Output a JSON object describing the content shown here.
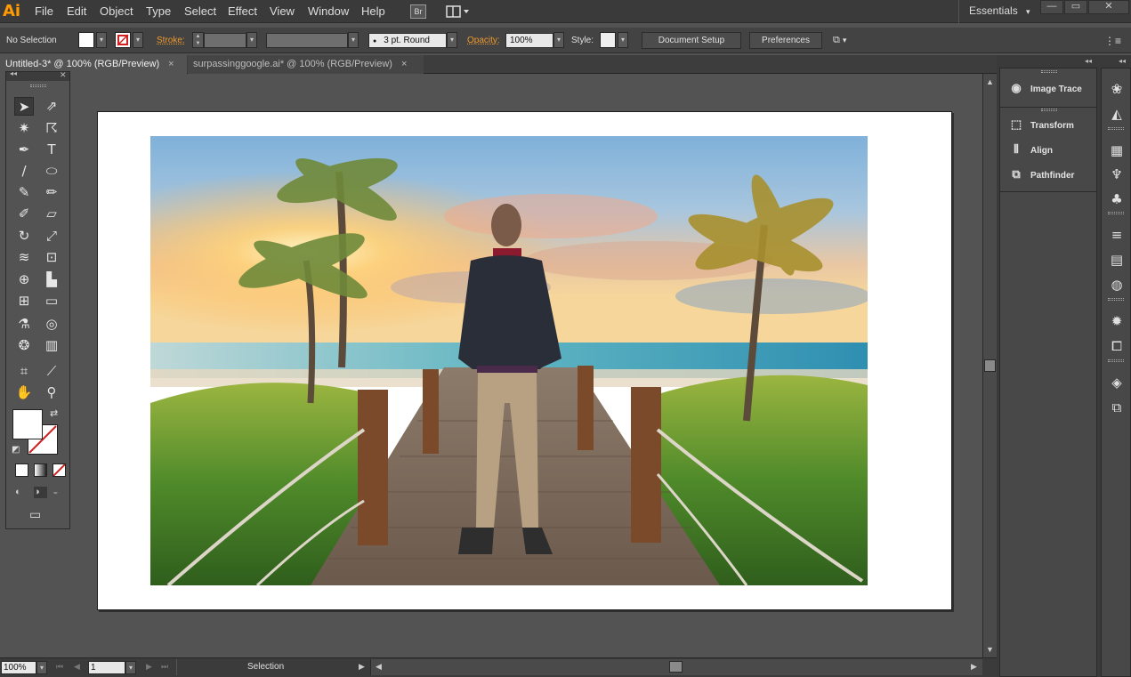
{
  "app": {
    "logo": "Ai"
  },
  "menu": [
    "File",
    "Edit",
    "Object",
    "Type",
    "Select",
    "Effect",
    "View",
    "Window",
    "Help"
  ],
  "bridge_label": "Br",
  "workspace": {
    "label": "Essentials",
    "caret": "▾"
  },
  "window_controls": {
    "minimize": "—",
    "restore": "▭",
    "close": "✕"
  },
  "control_bar": {
    "selection_status": "No Selection",
    "stroke_label": "Stroke:",
    "brush_value": "3 pt. Round",
    "opacity_label": "Opacity:",
    "opacity_value": "100%",
    "style_label": "Style:",
    "document_setup": "Document Setup",
    "preferences": "Preferences"
  },
  "tabs": [
    {
      "label": "Untitled-3* @ 100% (RGB/Preview)",
      "close": "×"
    },
    {
      "label": "surpassinggoogle.ai* @ 100% (RGB/Preview)",
      "close": "×"
    }
  ],
  "tools_panel": {
    "tools": [
      {
        "name": "selection-tool-icon",
        "glyph": "➤"
      },
      {
        "name": "direct-selection-tool-icon",
        "glyph": "⇗"
      },
      {
        "name": "magic-wand-tool-icon",
        "glyph": "✷"
      },
      {
        "name": "lasso-tool-icon",
        "glyph": "☈"
      },
      {
        "name": "pen-tool-icon",
        "glyph": "✒"
      },
      {
        "name": "type-tool-icon",
        "glyph": "T"
      },
      {
        "name": "line-tool-icon",
        "glyph": "∕"
      },
      {
        "name": "ellipse-tool-icon",
        "glyph": "⬭"
      },
      {
        "name": "paintbrush-tool-icon",
        "glyph": "✎"
      },
      {
        "name": "pencil-tool-icon",
        "glyph": "✏"
      },
      {
        "name": "blob-brush-tool-icon",
        "glyph": "✐"
      },
      {
        "name": "eraser-tool-icon",
        "glyph": "▱"
      },
      {
        "name": "rotate-tool-icon",
        "glyph": "↻"
      },
      {
        "name": "scale-tool-icon",
        "glyph": "⤢"
      },
      {
        "name": "width-tool-icon",
        "glyph": "≋"
      },
      {
        "name": "free-transform-tool-icon",
        "glyph": "⊡"
      },
      {
        "name": "shape-builder-tool-icon",
        "glyph": "⊕"
      },
      {
        "name": "graph-tool-icon",
        "glyph": "▙"
      },
      {
        "name": "mesh-tool-icon",
        "glyph": "⊞"
      },
      {
        "name": "gradient-tool-icon",
        "glyph": "▭"
      },
      {
        "name": "eyedropper-tool-icon",
        "glyph": "⚗"
      },
      {
        "name": "blend-tool-icon",
        "glyph": "◎"
      },
      {
        "name": "symbol-sprayer-tool-icon",
        "glyph": "❂"
      },
      {
        "name": "column-graph-tool-icon",
        "glyph": "▥"
      },
      {
        "name": "artboard-tool-icon",
        "glyph": "⌗"
      },
      {
        "name": "slice-tool-icon",
        "glyph": "⟋"
      },
      {
        "name": "hand-tool-icon",
        "glyph": "✋"
      },
      {
        "name": "zoom-tool-icon",
        "glyph": "⚲"
      }
    ],
    "color_modes": [
      "■",
      "◧",
      "⊘"
    ],
    "draw_modes": [
      "◐",
      "◑",
      "◒"
    ],
    "screen_mode": "▭"
  },
  "status_bar": {
    "zoom": "100%",
    "artboard_number": "1",
    "status_label": "Selection"
  },
  "right_panels": [
    {
      "name": "image-trace",
      "label": "Image Trace",
      "icon": "◉"
    },
    {
      "name": "transform",
      "label": "Transform",
      "icon": "⬚"
    },
    {
      "name": "align",
      "label": "Align",
      "icon": "⫴"
    },
    {
      "name": "pathfinder",
      "label": "Pathfinder",
      "icon": "⧉"
    }
  ],
  "dock_icons": [
    {
      "name": "color-guide-icon",
      "glyph": "❀"
    },
    {
      "name": "color-icon",
      "glyph": "◭"
    },
    {
      "name": "swatches-icon",
      "glyph": "▦"
    },
    {
      "name": "brushes-icon",
      "glyph": "♆"
    },
    {
      "name": "symbols-icon",
      "glyph": "♣"
    },
    {
      "name": "stroke-icon",
      "glyph": "≡"
    },
    {
      "name": "gradient-icon",
      "glyph": "▤"
    },
    {
      "name": "transparency-icon",
      "glyph": "◍"
    },
    {
      "name": "appearance-icon",
      "glyph": "✹"
    },
    {
      "name": "graphic-styles-icon",
      "glyph": "⧠"
    },
    {
      "name": "layers-icon",
      "glyph": "◈"
    },
    {
      "name": "artboards-icon",
      "glyph": "⧉"
    }
  ]
}
